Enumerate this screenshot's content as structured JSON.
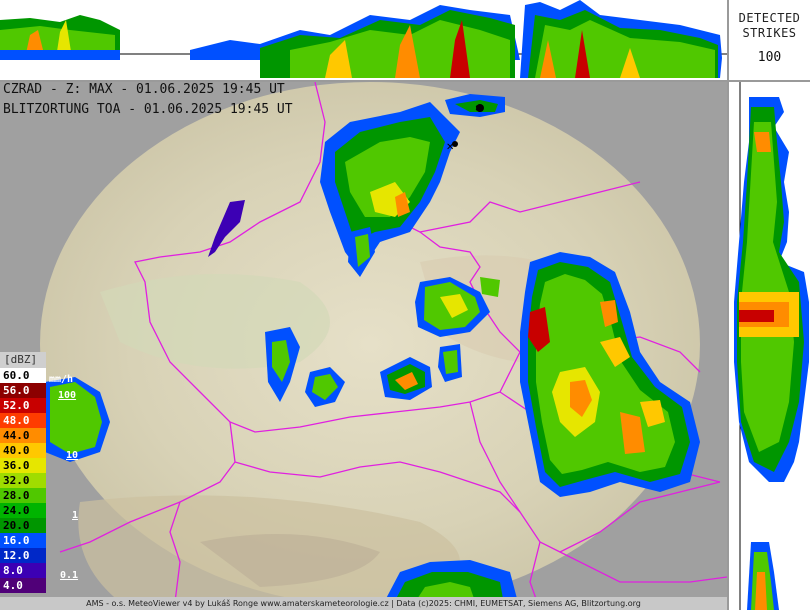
{
  "header": {
    "strikes_label_line1": "DETECTED",
    "strikes_label_line2": "STRIKES",
    "strikes_count": "100"
  },
  "overlay": {
    "radar_line": "CZRAD - Z: MAX - 01.06.2025 19:45 UT",
    "lightning_line": "BLITZORTUNG TOA - 01.06.2025 19:45 UT"
  },
  "legend": {
    "unit_dbz": "[dBZ]",
    "unit_rate": "mm/h",
    "rows": [
      {
        "label": "60.0",
        "color": "#ffffff",
        "text": "#000000"
      },
      {
        "label": "56.0",
        "color": "#8c0000",
        "text": "#ffffff"
      },
      {
        "label": "52.0",
        "color": "#c80000",
        "text": "#ffffff"
      },
      {
        "label": "48.0",
        "color": "#ff3c00",
        "text": "#ffffff"
      },
      {
        "label": "44.0",
        "color": "#ff8c00",
        "text": "#000000"
      },
      {
        "label": "40.0",
        "color": "#ffc800",
        "text": "#000000"
      },
      {
        "label": "36.0",
        "color": "#e6e600",
        "text": "#000000"
      },
      {
        "label": "32.0",
        "color": "#a0dc00",
        "text": "#000000"
      },
      {
        "label": "28.0",
        "color": "#50c800",
        "text": "#000000"
      },
      {
        "label": "24.0",
        "color": "#00b400",
        "text": "#000000"
      },
      {
        "label": "20.0",
        "color": "#009600",
        "text": "#000000"
      },
      {
        "label": "16.0",
        "color": "#0050ff",
        "text": "#ffffff"
      },
      {
        "label": "12.0",
        "color": "#0028c8",
        "text": "#ffffff"
      },
      {
        "label": "8.0",
        "color": "#3c00b4",
        "text": "#ffffff"
      },
      {
        "label": "4.0",
        "color": "#500078",
        "text": "#ffffff"
      }
    ],
    "rates": [
      "100",
      "10",
      "1",
      "0.1"
    ]
  },
  "footer": "AMS - o.s. MeteoViewer v4 by Lukáš Ronge www.amaterskameteorologie.cz | Data (c)2025: CHMI, EUMETSAT, Siemens AG, Blitzortung.org"
}
